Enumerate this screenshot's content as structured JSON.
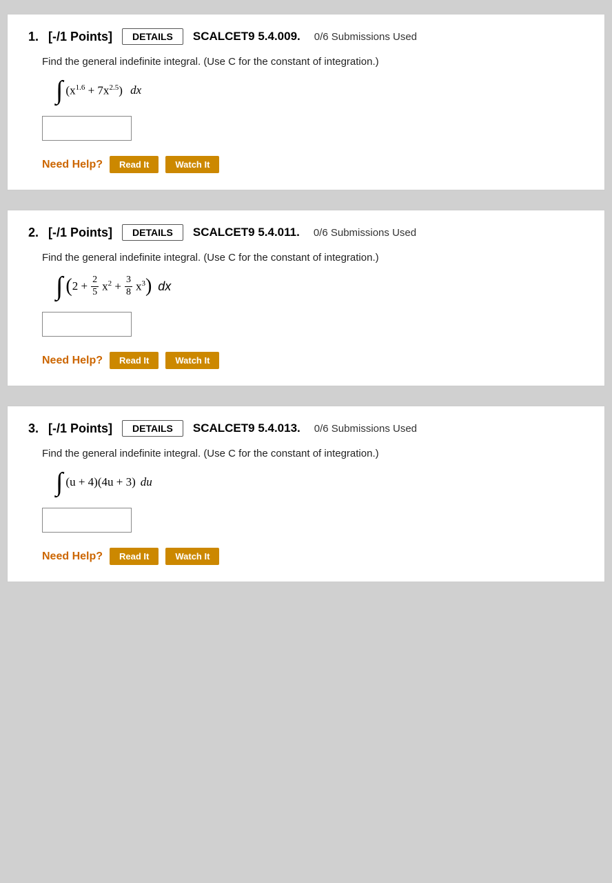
{
  "problems": [
    {
      "id": "p1",
      "number": "1.",
      "points_label": "[-/1 Points]",
      "details_label": "DETAILS",
      "code": "SCALCET9 5.4.009.",
      "submissions": "0/6 Submissions Used",
      "instruction": "Find the general indefinite integral. (Use C for the constant of integration.)",
      "need_help_label": "Need Help?",
      "read_it_label": "Read It",
      "watch_it_label": "Watch It"
    },
    {
      "id": "p2",
      "number": "2.",
      "points_label": "[-/1 Points]",
      "details_label": "DETAILS",
      "code": "SCALCET9 5.4.011.",
      "submissions": "0/6 Submissions Used",
      "instruction": "Find the general indefinite integral. (Use C for the constant of integration.)",
      "need_help_label": "Need Help?",
      "read_it_label": "Read It",
      "watch_it_label": "Watch It"
    },
    {
      "id": "p3",
      "number": "3.",
      "points_label": "[-/1 Points]",
      "details_label": "DETAILS",
      "code": "SCALCET9 5.4.013.",
      "submissions": "0/6 Submissions Used",
      "instruction": "Find the general indefinite integral. (Use C for the constant of integration.)",
      "need_help_label": "Need Help?",
      "read_it_label": "Read It",
      "watch_it_label": "Watch It"
    }
  ]
}
